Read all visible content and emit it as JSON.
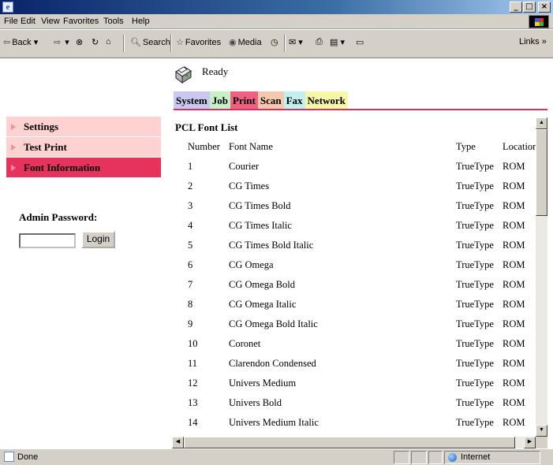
{
  "window": {
    "minimize": "_",
    "maximize": "□",
    "close": "×"
  },
  "menu": [
    "File",
    "Edit",
    "View",
    "Favorites",
    "Tools",
    "Help"
  ],
  "toolbar": {
    "back": "Back",
    "search": "Search",
    "favorites": "Favorites",
    "media": "Media",
    "links": "Links »"
  },
  "status": {
    "text": "Ready"
  },
  "tabs": [
    {
      "label": "System",
      "color": "#c8c8f0"
    },
    {
      "label": "Job",
      "color": "#c6f0c6"
    },
    {
      "label": "Print",
      "color": "#f06080"
    },
    {
      "label": "Scan",
      "color": "#f7c8b0"
    },
    {
      "label": "Fax",
      "color": "#c0f0f0"
    },
    {
      "label": "Network",
      "color": "#f7f7a8"
    }
  ],
  "sidebar": {
    "items": [
      {
        "label": "Settings",
        "bg": "#ffd2d2",
        "active": false
      },
      {
        "label": "Test Print",
        "bg": "#ffd2d2",
        "active": false
      },
      {
        "label": "Font Information",
        "bg": "#e6335e",
        "active": true
      }
    ],
    "admin_label": "Admin Password:",
    "login_label": "Login"
  },
  "font_list": {
    "title": "PCL Font List",
    "headers": {
      "number": "Number",
      "name": "Font Name",
      "type": "Type",
      "location": "Location"
    },
    "rows": [
      {
        "number": "1",
        "name": "Courier",
        "type": "TrueType",
        "location": "ROM"
      },
      {
        "number": "2",
        "name": "CG Times",
        "type": "TrueType",
        "location": "ROM"
      },
      {
        "number": "3",
        "name": "CG Times Bold",
        "type": "TrueType",
        "location": "ROM"
      },
      {
        "number": "4",
        "name": "CG Times Italic",
        "type": "TrueType",
        "location": "ROM"
      },
      {
        "number": "5",
        "name": "CG Times Bold Italic",
        "type": "TrueType",
        "location": "ROM"
      },
      {
        "number": "6",
        "name": "CG Omega",
        "type": "TrueType",
        "location": "ROM"
      },
      {
        "number": "7",
        "name": "CG Omega Bold",
        "type": "TrueType",
        "location": "ROM"
      },
      {
        "number": "8",
        "name": "CG Omega Italic",
        "type": "TrueType",
        "location": "ROM"
      },
      {
        "number": "9",
        "name": "CG Omega Bold Italic",
        "type": "TrueType",
        "location": "ROM"
      },
      {
        "number": "10",
        "name": "Coronet",
        "type": "TrueType",
        "location": "ROM"
      },
      {
        "number": "11",
        "name": "Clarendon Condensed",
        "type": "TrueType",
        "location": "ROM"
      },
      {
        "number": "12",
        "name": "Univers Medium",
        "type": "TrueType",
        "location": "ROM"
      },
      {
        "number": "13",
        "name": "Univers Bold",
        "type": "TrueType",
        "location": "ROM"
      },
      {
        "number": "14",
        "name": "Univers Medium Italic",
        "type": "TrueType",
        "location": "ROM"
      }
    ]
  },
  "statusbar": {
    "text": "Done",
    "zone": "Internet"
  },
  "colors": {
    "accent": "#d3335c"
  }
}
